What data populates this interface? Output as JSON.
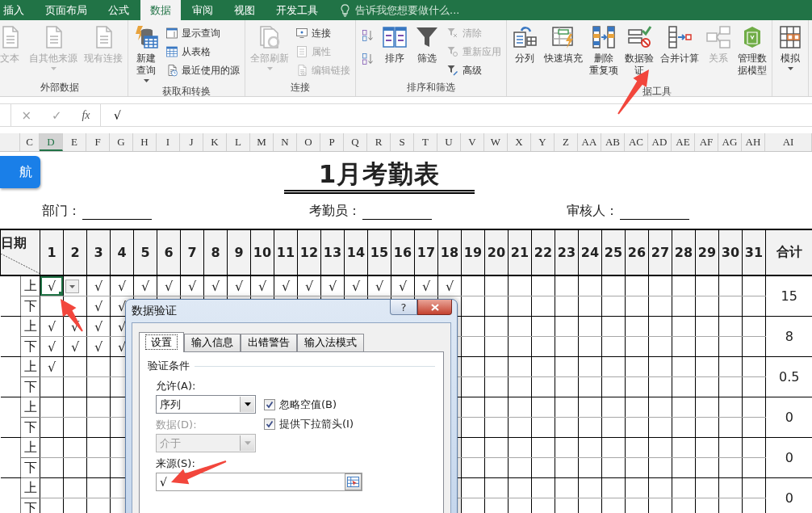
{
  "ribbon_tabs": [
    {
      "label": "插入",
      "selected": false
    },
    {
      "label": "页面布局",
      "selected": false
    },
    {
      "label": "公式",
      "selected": false
    },
    {
      "label": "数据",
      "selected": true
    },
    {
      "label": "审阅",
      "selected": false
    },
    {
      "label": "视图",
      "selected": false
    },
    {
      "label": "开发工具",
      "selected": false
    }
  ],
  "tell_me": {
    "placeholder": "告诉我您想要做什么..."
  },
  "ribbon_groups": [
    {
      "label": "外部数据",
      "items": [
        {
          "kind": "large",
          "label": "文本",
          "disabled": true
        },
        {
          "kind": "large",
          "label": "自其他来源",
          "disabled": true,
          "dropdown": true
        },
        {
          "kind": "large",
          "label": "现有连接",
          "disabled": true
        }
      ]
    },
    {
      "label": "获取和转换",
      "items": [
        {
          "kind": "large",
          "lines": [
            "新建",
            "查询"
          ],
          "disabled": false,
          "dropdown": true
        },
        {
          "kind": "small",
          "label": "显示查询",
          "disabled": false
        },
        {
          "kind": "small",
          "label": "从表格",
          "disabled": false
        },
        {
          "kind": "small",
          "label": "最近使用的源",
          "disabled": false
        }
      ]
    },
    {
      "label": "连接",
      "items": [
        {
          "kind": "large",
          "label": "全部刷新",
          "disabled": true,
          "dropdown": true
        },
        {
          "kind": "small",
          "label": "连接",
          "disabled": false
        },
        {
          "kind": "small",
          "label": "属性",
          "disabled": true
        },
        {
          "kind": "small",
          "label": "编辑链接",
          "disabled": true
        }
      ]
    },
    {
      "label": "排序和筛选",
      "items": [
        {
          "kind": "icon",
          "disabled": false
        },
        {
          "kind": "icon",
          "disabled": false
        },
        {
          "kind": "large",
          "label": "排序",
          "disabled": false
        },
        {
          "kind": "large",
          "label": "筛选",
          "disabled": false
        },
        {
          "kind": "small",
          "label": "清除",
          "disabled": true
        },
        {
          "kind": "small",
          "label": "重新应用",
          "disabled": true
        },
        {
          "kind": "small",
          "label": "高级",
          "disabled": false
        }
      ]
    },
    {
      "label": "据工具",
      "items": [
        {
          "kind": "large",
          "label": "分列",
          "disabled": false
        },
        {
          "kind": "large",
          "label": "快速填充",
          "disabled": false
        },
        {
          "kind": "large",
          "lines": [
            "删除",
            "重复项"
          ],
          "disabled": false
        },
        {
          "kind": "large",
          "lines": [
            "数据验",
            "证"
          ],
          "disabled": false,
          "dropdown": true
        },
        {
          "kind": "large",
          "label": "合并计算",
          "disabled": false
        },
        {
          "kind": "large",
          "label": "关系",
          "disabled": true
        },
        {
          "kind": "large",
          "lines": [
            "管理数",
            "据模型"
          ],
          "disabled": false
        }
      ]
    },
    {
      "items": [
        {
          "kind": "large",
          "label": "模拟",
          "disabled": false,
          "dropdown": true
        }
      ]
    }
  ],
  "formula_bar": {
    "cancel": "×",
    "enter": "✓",
    "function": "fx",
    "value": "√"
  },
  "sheet": {
    "column_headers": [
      {
        "label": "C",
        "selected": false
      },
      {
        "label": "D",
        "selected": true
      },
      {
        "label": "E",
        "selected": false
      },
      {
        "label": "F",
        "selected": false
      },
      {
        "label": "G",
        "selected": false
      },
      {
        "label": "H",
        "selected": false
      },
      {
        "label": "I",
        "selected": false
      },
      {
        "label": "J",
        "selected": false
      },
      {
        "label": "K",
        "selected": false
      },
      {
        "label": "L",
        "selected": false
      },
      {
        "label": "M",
        "selected": false
      },
      {
        "label": "N",
        "selected": false
      },
      {
        "label": "O",
        "selected": false
      },
      {
        "label": "P",
        "selected": false
      },
      {
        "label": "Q",
        "selected": false
      },
      {
        "label": "R",
        "selected": false
      },
      {
        "label": "S",
        "selected": false
      },
      {
        "label": "T",
        "selected": false
      },
      {
        "label": "U",
        "selected": false
      },
      {
        "label": "V",
        "selected": false
      },
      {
        "label": "W",
        "selected": false
      },
      {
        "label": "X",
        "selected": false
      },
      {
        "label": "Y",
        "selected": false
      },
      {
        "label": "Z",
        "selected": false
      },
      {
        "label": "AA",
        "selected": false
      },
      {
        "label": "AB",
        "selected": false
      },
      {
        "label": "AC",
        "selected": false
      },
      {
        "label": "AD",
        "selected": false
      },
      {
        "label": "AE",
        "selected": false
      },
      {
        "label": "AF",
        "selected": false
      },
      {
        "label": "AG",
        "selected": false
      },
      {
        "label": "AH",
        "selected": false
      },
      {
        "label": "AI",
        "selected": false
      }
    ],
    "nav_button": {
      "label": "航"
    },
    "title": "1月考勤表",
    "info_fields": [
      {
        "label": "部门："
      },
      {
        "label": "考勤员："
      },
      {
        "label": "审核人："
      }
    ],
    "table": {
      "corner_label": "日期",
      "total_header": "合计",
      "validation_dropdown": true,
      "days": [
        "1",
        "2",
        "3",
        "4",
        "5",
        "6",
        "7",
        "8",
        "9",
        "10",
        "11",
        "12",
        "13",
        "14",
        "15",
        "16",
        "17",
        "18",
        "19",
        "20",
        "21",
        "22",
        "23",
        "24",
        "25",
        "26",
        "27",
        "28",
        "29",
        "30",
        "31"
      ],
      "groups": [
        {
          "total": "15",
          "shifts": [
            {
              "label": "上",
              "selected_days": {
                "d1": true
              },
              "marks": {
                "1": "√",
                "3": "√",
                "4": "√",
                "5": "√",
                "6": "√",
                "7": "√",
                "8": "√",
                "9": "√",
                "10": "√",
                "11": "√",
                "12": "√",
                "13": "√",
                "14": "√",
                "15": "√",
                "16": "√",
                "17": "√",
                "18": "√"
              }
            },
            {
              "label": "下",
              "marks": {
                "3": "√",
                "4": "√"
              }
            }
          ]
        },
        {
          "total": "8",
          "shifts": [
            {
              "label": "上",
              "marks": {
                "1": "√",
                "2": "√",
                "3": "√",
                "4": "√"
              }
            },
            {
              "label": "下",
              "marks": {
                "1": "√",
                "2": "√",
                "3": "√",
                "4": "√"
              }
            }
          ]
        },
        {
          "total": "0.5",
          "shifts": [
            {
              "label": "上",
              "marks": {
                "1": "√"
              }
            },
            {
              "label": "下"
            }
          ]
        },
        {
          "total": "0",
          "shifts": [
            {
              "label": "上"
            },
            {
              "label": "下"
            }
          ]
        },
        {
          "total": "0",
          "shifts": [
            {
              "label": "上"
            },
            {
              "label": "下"
            }
          ]
        },
        {
          "total": "0",
          "shifts": [
            {
              "label": "上"
            },
            {
              "label": "下"
            }
          ]
        }
      ]
    }
  },
  "dialog": {
    "title": "数据验证",
    "help": "?",
    "tabs": [
      {
        "label": "设置",
        "selected": true
      },
      {
        "label": "输入信息",
        "selected": false
      },
      {
        "label": "出错警告",
        "selected": false
      },
      {
        "label": "输入法模式",
        "selected": false
      }
    ],
    "section": "验证条件",
    "allow": {
      "label": "允许(A):",
      "value": "序列",
      "disabled": false
    },
    "data": {
      "label": "数据(D):",
      "value": "介于",
      "disabled": true
    },
    "checkboxes": [
      {
        "label": "忽略空值(B)",
        "checked": true
      },
      {
        "label": "提供下拉箭头(I)",
        "checked": true
      }
    ],
    "source": {
      "label": "来源(S):",
      "value": "√"
    }
  }
}
